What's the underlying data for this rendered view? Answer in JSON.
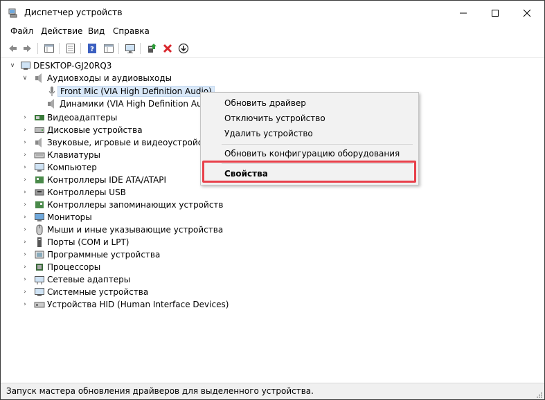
{
  "window": {
    "title": "Диспетчер устройств"
  },
  "menu": [
    "Файл",
    "Действие",
    "Вид",
    "Справка"
  ],
  "toolbar": {
    "icons": [
      "back-arrow-icon",
      "forward-arrow-icon",
      "properties-grid-icon",
      "doc-icon",
      "help-icon",
      "grid-icon",
      "monitor-scan-icon",
      "add-driver-icon",
      "remove-x-icon",
      "download-icon"
    ],
    "accent_red": "#d9262c",
    "accent_green": "#2e9b3a"
  },
  "tree": {
    "root": "DESKTOP-GJ20RQ3",
    "audio_category": "Аудиовходы и аудиовыходы",
    "audio_children": [
      "Front Mic (VIA High Definition Audio)",
      "Динамики (VIA High Definition Audio"
    ],
    "categories": [
      "Видеоадаптеры",
      "Дисковые устройства",
      "Звуковые, игровые и видеоустройства",
      "Клавиатуры",
      "Компьютер",
      "Контроллеры IDE ATA/ATAPI",
      "Контроллеры USB",
      "Контроллеры запоминающих устройств",
      "Мониторы",
      "Мыши и иные указывающие устройства",
      "Порты (COM и LPT)",
      "Программные устройства",
      "Процессоры",
      "Сетевые адаптеры",
      "Системные устройства",
      "Устройства HID (Human Interface Devices)"
    ]
  },
  "context_menu": {
    "update_driver": "Обновить драйвер",
    "disable_device": "Отключить устройство",
    "uninstall_device": "Удалить устройство",
    "scan_hardware": "Обновить конфигурацию оборудования",
    "properties": "Свойства",
    "highlight_color": "#e8404a"
  },
  "status": {
    "text": "Запуск мастера обновления драйверов для выделенного устройства."
  }
}
